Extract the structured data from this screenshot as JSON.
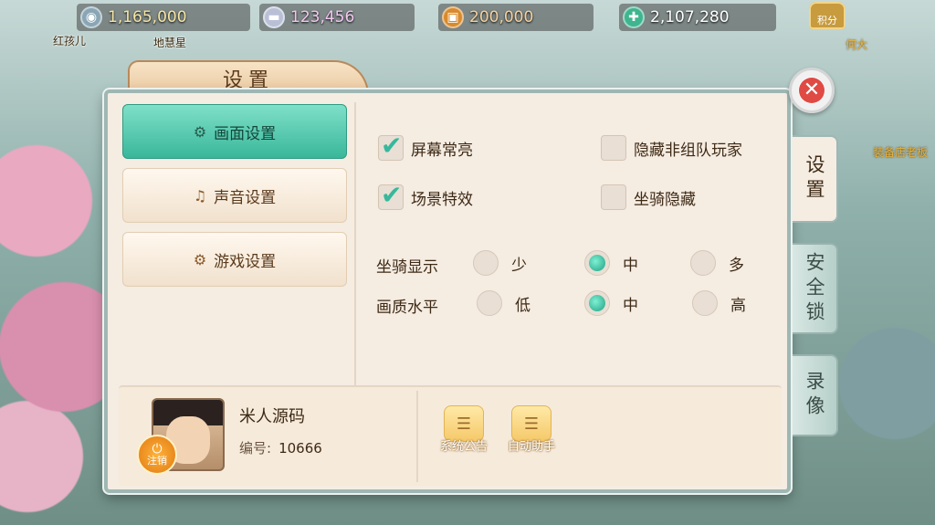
{
  "currencies": [
    {
      "icon": "coin-bag-icon",
      "value": "1,165,000"
    },
    {
      "icon": "silver-ingot-icon",
      "value": "123,456"
    },
    {
      "icon": "copper-coin-icon",
      "value": "200,000"
    },
    {
      "icon": "jade-icon",
      "value": "2,107,280"
    }
  ],
  "jifen_label": "积分",
  "background_npcs": [
    "红孩儿",
    "地慧星",
    "何大",
    "装备店老板"
  ],
  "panel": {
    "title": "设置",
    "close_glyph": "✕",
    "menu": [
      {
        "label": "画面设置",
        "icon": "gears-icon",
        "active": true
      },
      {
        "label": "声音设置",
        "icon": "music-note-icon",
        "active": false
      },
      {
        "label": "游戏设置",
        "icon": "gear-icon",
        "active": false
      }
    ],
    "checkboxes": [
      {
        "label": "屏幕常亮",
        "checked": true
      },
      {
        "label": "隐藏非组队玩家",
        "checked": false
      },
      {
        "label": "场景特效",
        "checked": true
      },
      {
        "label": "坐骑隐藏",
        "checked": false
      }
    ],
    "radio_rows": [
      {
        "label": "坐骑显示",
        "options": [
          "少",
          "中",
          "多"
        ],
        "selected": "中"
      },
      {
        "label": "画质水平",
        "options": [
          "低",
          "中",
          "高"
        ],
        "selected": "中"
      }
    ],
    "player": {
      "name": "米人源码",
      "id_label": "编号:",
      "id_value": "10666",
      "logout_label": "注销"
    },
    "tools": [
      {
        "label": "系统公告",
        "icon": "scroll-icon"
      },
      {
        "label": "自动助手",
        "icon": "scroll-icon"
      }
    ]
  },
  "side_tabs": [
    {
      "label": "设置",
      "active": true
    },
    {
      "label": "安全锁",
      "active": false
    },
    {
      "label": "录像",
      "active": false
    }
  ],
  "colors": {
    "accent": "#39b79a",
    "panel_bg": "#f5ece2",
    "close_red": "#e04a44"
  }
}
